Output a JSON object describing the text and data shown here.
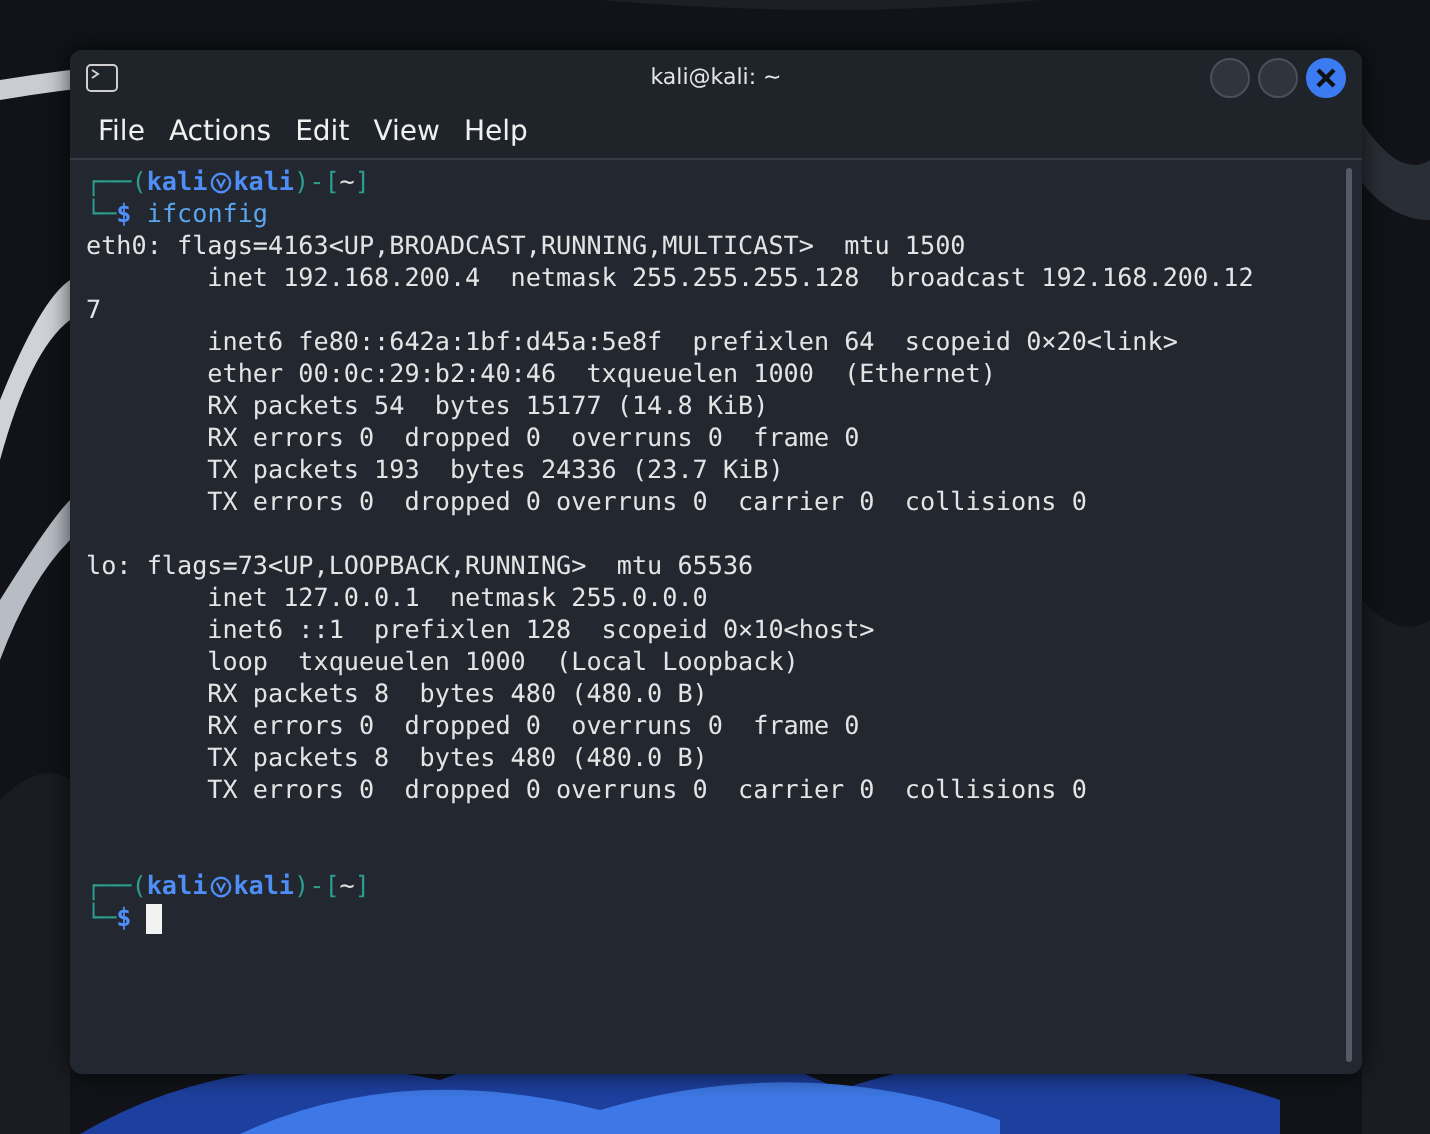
{
  "window": {
    "title": "kali@kali: ~",
    "buttons": [
      {
        "kind": "minimize"
      },
      {
        "kind": "maximize"
      },
      {
        "kind": "close"
      }
    ]
  },
  "menu": [
    "File",
    "Actions",
    "Edit",
    "View",
    "Help"
  ],
  "terminal": {
    "lines": [
      {
        "kind": "prompt",
        "corner_top": "┌──(",
        "user": "kali",
        "host": "kali",
        "dir_open": ")-[",
        "dir": "~",
        "dir_close": "]",
        "corner_bottom": "└─",
        "symbol": "$",
        "command": "ifconfig",
        "cursor": false
      },
      {
        "kind": "output",
        "text": "eth0: flags=4163<UP,BROADCAST,RUNNING,MULTICAST>  mtu 1500"
      },
      {
        "kind": "output",
        "text": "        inet 192.168.200.4  netmask 255.255.255.128  broadcast 192.168.200.12"
      },
      {
        "kind": "output",
        "text": "7"
      },
      {
        "kind": "output",
        "text": "        inet6 fe80::642a:1bf:d45a:5e8f  prefixlen 64  scopeid 0×20<link>"
      },
      {
        "kind": "output",
        "text": "        ether 00:0c:29:b2:40:46  txqueuelen 1000  (Ethernet)"
      },
      {
        "kind": "output",
        "text": "        RX packets 54  bytes 15177 (14.8 KiB)"
      },
      {
        "kind": "output",
        "text": "        RX errors 0  dropped 0  overruns 0  frame 0"
      },
      {
        "kind": "output",
        "text": "        TX packets 193  bytes 24336 (23.7 KiB)"
      },
      {
        "kind": "output",
        "text": "        TX errors 0  dropped 0 overruns 0  carrier 0  collisions 0"
      },
      {
        "kind": "blank"
      },
      {
        "kind": "output",
        "text": "lo: flags=73<UP,LOOPBACK,RUNNING>  mtu 65536"
      },
      {
        "kind": "output",
        "text": "        inet 127.0.0.1  netmask 255.0.0.0"
      },
      {
        "kind": "output",
        "text": "        inet6 ::1  prefixlen 128  scopeid 0×10<host>"
      },
      {
        "kind": "output",
        "text": "        loop  txqueuelen 1000  (Local Loopback)"
      },
      {
        "kind": "output",
        "text": "        RX packets 8  bytes 480 (480.0 B)"
      },
      {
        "kind": "output",
        "text": "        RX errors 0  dropped 0  overruns 0  frame 0"
      },
      {
        "kind": "output",
        "text": "        TX packets 8  bytes 480 (480.0 B)"
      },
      {
        "kind": "output",
        "text": "        TX errors 0  dropped 0 overruns 0  carrier 0  collisions 0"
      },
      {
        "kind": "blank"
      },
      {
        "kind": "blank"
      },
      {
        "kind": "prompt",
        "corner_top": "┌──(",
        "user": "kali",
        "host": "kali",
        "dir_open": ")-[",
        "dir": "~",
        "dir_close": "]",
        "corner_bottom": "└─",
        "symbol": "$",
        "cursor": true
      }
    ]
  }
}
